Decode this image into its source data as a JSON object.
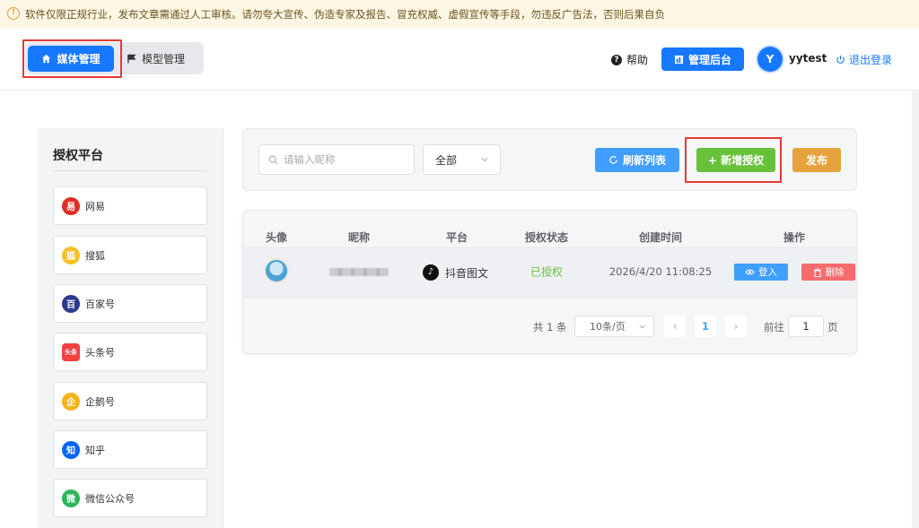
{
  "notice": {
    "text": "软件仅限正规行业，发布文章需通过人工审核。请勿夸大宣传、伪造专家及报告、冒充权威、虚假宣传等手段，勿违反广告法，否则后果自负"
  },
  "header": {
    "tabs": [
      {
        "label": "媒体管理",
        "active": true
      },
      {
        "label": "模型管理",
        "active": false
      }
    ],
    "help_label": "帮助",
    "admin_label": "管理后台",
    "avatar_letter": "Y",
    "username": "yytest",
    "logout_label": "退出登录"
  },
  "sidebar": {
    "title": "授权平台",
    "items": [
      {
        "label": "网易",
        "icon": "netease-icon",
        "glyph": "易",
        "color": "#e02e24"
      },
      {
        "label": "搜狐",
        "icon": "sohu-icon",
        "glyph": "狐",
        "color": "#f4c025"
      },
      {
        "label": "百家号",
        "icon": "baijiahao-icon",
        "glyph": "百",
        "color": "#2a3a8c"
      },
      {
        "label": "头条号",
        "icon": "toutiao-icon",
        "glyph": "头条",
        "color": "#f04142"
      },
      {
        "label": "企鹅号",
        "icon": "qie-icon",
        "glyph": "企",
        "color": "#f5b415"
      },
      {
        "label": "知乎",
        "icon": "zhihu-icon",
        "glyph": "知",
        "color": "#0066ff"
      },
      {
        "label": "微信公众号",
        "icon": "wechat-icon",
        "glyph": "微",
        "color": "#2bb55a"
      }
    ]
  },
  "toolbar": {
    "search_placeholder": "请输入昵称",
    "filter_value": "全部",
    "refresh_label": "刷新列表",
    "add_label": "+ 新增授权",
    "publish_label": "发布"
  },
  "table": {
    "columns": [
      "头像",
      "昵称",
      "平台",
      "授权状态",
      "创建时间",
      "操作"
    ],
    "rows": [
      {
        "nickname": "",
        "platform": "抖音图文",
        "status": "已授权",
        "created": "2026/4/20 11:08:25",
        "login_label": "登入",
        "delete_label": "删除"
      }
    ]
  },
  "pagination": {
    "total": "共 1 条",
    "page_size": "10条/页",
    "current_page": "1",
    "goto_label": "前往",
    "goto_value": "1",
    "page_unit": "页"
  },
  "colors": {
    "primary": "#1677ff",
    "success": "#67c23a",
    "warning": "#e6a23c",
    "danger": "#f56c6c",
    "highlight": "#e53935"
  }
}
